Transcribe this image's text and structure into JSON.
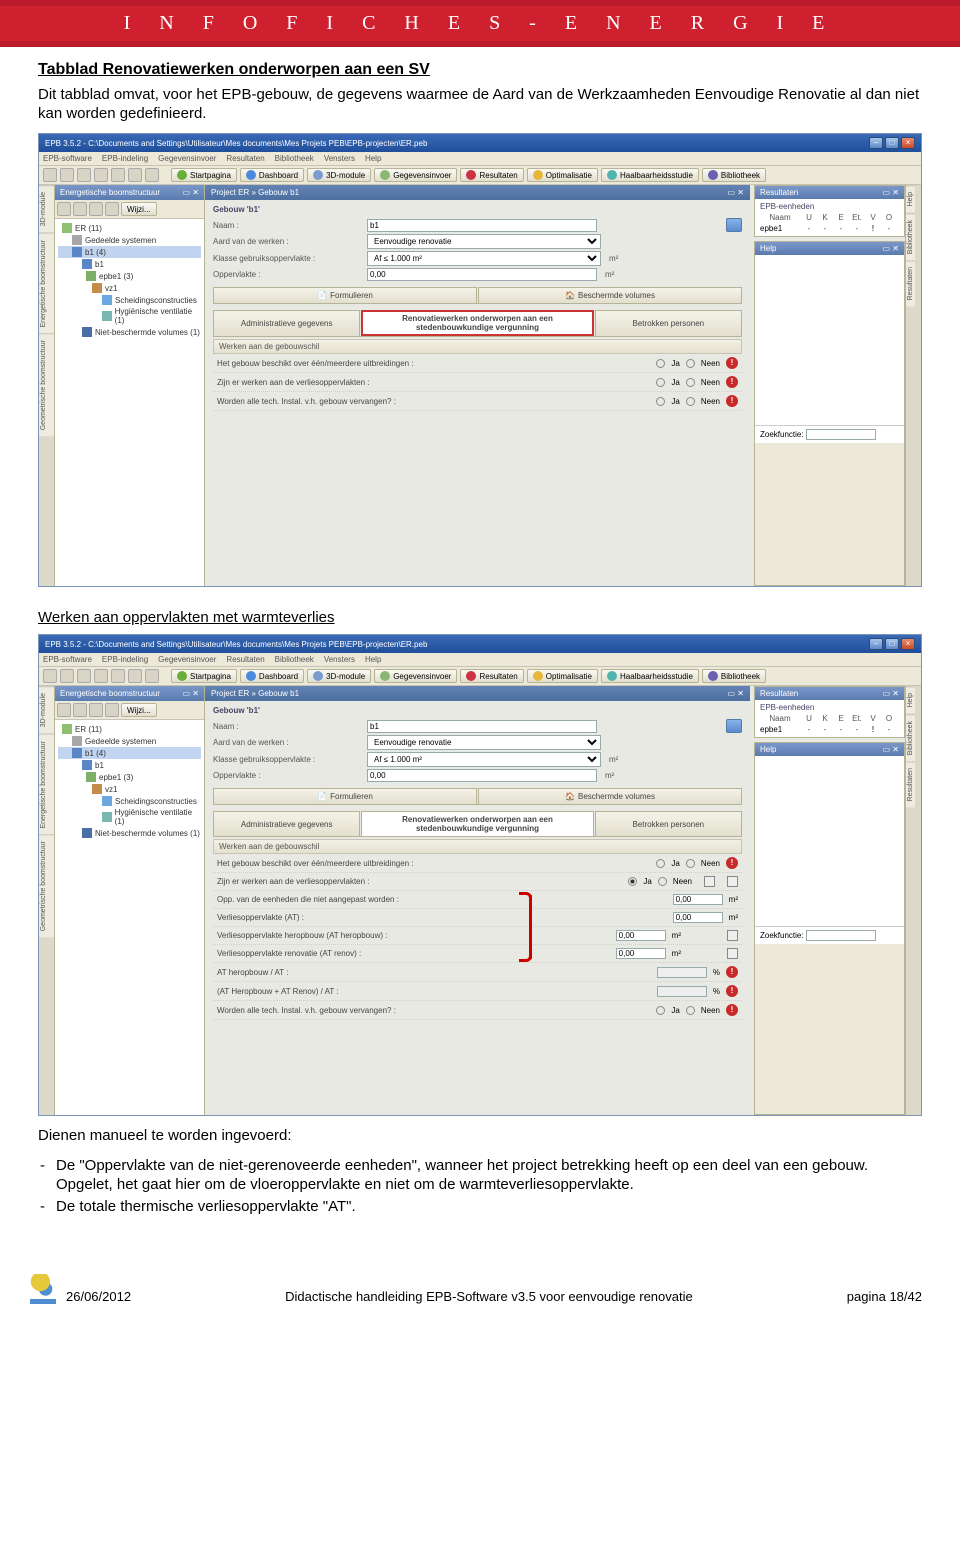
{
  "header_band": "I N F O F I C H E S - E N E R G I E",
  "section_title": "Tabblad Renovatiewerken onderworpen aan een SV",
  "intro_para": "Dit tabblad omvat, voor het EPB-gebouw, de gegevens waarmee de Aard van de Werkzaamheden Eenvoudige Renovatie al dan niet kan worden gedefinieerd.",
  "subheading": "Werken aan oppervlakten met warmteverlies",
  "outro_lead": "Dienen manueel te worden ingevoerd:",
  "bullet1": "De \"Oppervlakte van de niet-gerenoveerde eenheden\", wanneer het project betrekking heeft op een deel van een gebouw. Opgelet, het gaat hier om de vloeroppervlakte en niet om de warmteverliesoppervlakte.",
  "bullet2": "De totale thermische verliesoppervlakte \"AT\".",
  "footer": {
    "date": "26/06/2012",
    "title": "Didactische handleiding EPB-Software v3.5 voor eenvoudige renovatie",
    "page": "pagina 18/42"
  },
  "app": {
    "title": "EPB 3.5.2 - C:\\Documents and Settings\\Utilisateur\\Mes documents\\Mes Projets PEB\\EPB-projecten\\ER.peb",
    "menus": [
      "EPB-software",
      "EPB-indeling",
      "Gegevensinvoer",
      "Resultaten",
      "Bibliotheek",
      "Vensters",
      "Help"
    ],
    "navbtns": [
      "Startpagina",
      "Dashboard",
      "3D-module",
      "Gegevensinvoer",
      "Resultaten",
      "Optimalisatie",
      "Haalbaarheidsstudie",
      "Bibliotheek"
    ],
    "tree_head": "Energetische boomstructuur",
    "tree": {
      "root": "ER (11)",
      "shared": "Gedeelde systemen",
      "bld_group": "b1 (4)",
      "bld": "b1",
      "unit": "epbe1 (3)",
      "vol": "vz1",
      "sch": "Scheidingsconstructies",
      "vent": "Hygiënische ventilatie (1)",
      "nonprot": "Niet-beschermde volumes (1)"
    },
    "breadcrumb": "Project ER  »  Gebouw b1",
    "form": {
      "section": "Gebouw 'b1'",
      "naam_label": "Naam :",
      "naam_val": "b1",
      "aard_label": "Aard van de werken :",
      "aard_val": "Eenvoudige renovatie",
      "klasse_label": "Klasse gebruiksoppervlakte :",
      "klasse_val": "Af ≤ 1.000 m²",
      "opp_label": "Oppervlakte :",
      "opp_val": "0,00",
      "opp_unit": "m²"
    },
    "toptabs": [
      "Formulieren",
      "Beschermde volumes"
    ],
    "subtabs": [
      "Administratieve gegevens",
      "Renovatiewerken onderworpen aan een stedenbouwkundige vergunning",
      "Betrokken personen"
    ],
    "section2": "Werken aan de gebouwschil",
    "q1": "Het gebouw beschikt over één/meerdere uitbreidingen :",
    "q2": "Zijn er werken aan de verliesoppervlakten :",
    "q3": "Worden alle tech. Instal. v.h. gebouw vervangen? :",
    "ja": "Ja",
    "neen": "Neen",
    "extra": {
      "opp_eenh": "Opp. van de eenheden die niet aangepast worden :",
      "at": "Verliesoppervlakte (AT) :",
      "at_h": "Verliesoppervlakte heropbouw (AT heropbouw) :",
      "at_r": "Verliesoppervlakte renovatie (AT renov) :",
      "ratio1": "AT heropbouw / AT :",
      "ratio2": "(AT Heropbouw + AT Renov) / AT :",
      "val0": "0,00",
      "m2": "m²",
      "pct": "%"
    },
    "right": {
      "res_head": "Resultaten",
      "eisen_head": "EPB-eenheden",
      "cols": [
        "Naam",
        "U",
        "K",
        "E",
        "Et.",
        "V",
        "O"
      ],
      "row": "epbe1",
      "help_head": "Help",
      "search_label": "Zoekfunctie:"
    },
    "wijz_btn": "Wijzi..."
  }
}
